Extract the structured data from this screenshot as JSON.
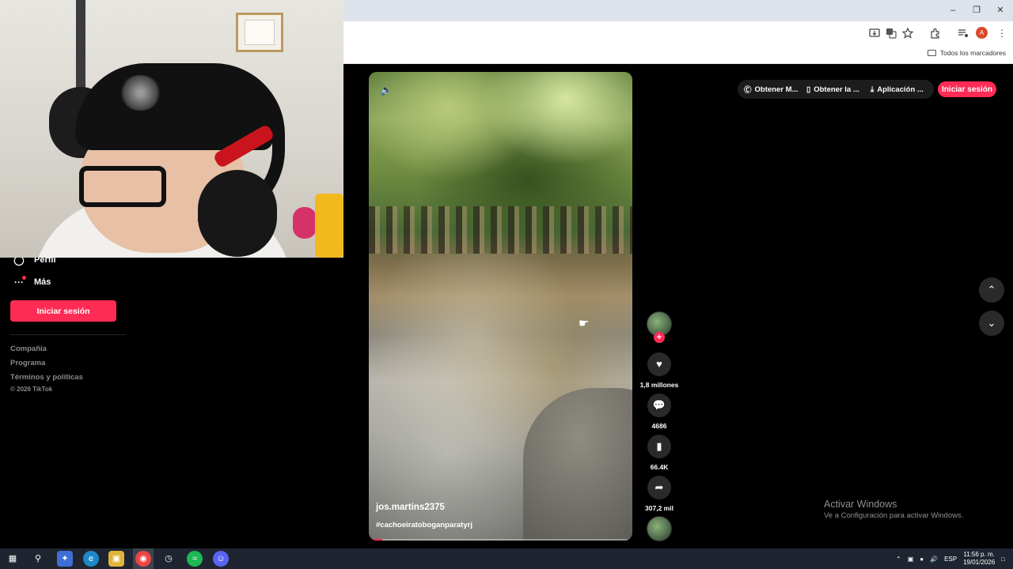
{
  "sidebar": {
    "items": [
      {
        "label": "Perfil",
        "icon": "person-icon"
      },
      {
        "label": "Más",
        "icon": "more-icon"
      }
    ],
    "login_label": "Iniciar sesión",
    "footer_links": [
      "Compañía",
      "Programa",
      "Términos y políticas"
    ],
    "copyright": "© 2026 TikTok"
  },
  "video": {
    "username": "jos.martins2375",
    "hashtag": "#cachoeiratoboganparatyrj",
    "progress_fraction": 0.05
  },
  "actions": {
    "likes": "1,8 millones",
    "comments": "4686",
    "saves": "66.4K",
    "shares": "307,2 mil"
  },
  "header": {
    "pill1": "Obtener M...",
    "pill2": "Obtener la ...",
    "pill3": "Aplicación ...",
    "login_label": "Iniciar sesión"
  },
  "browser": {
    "bookmarks_label": "Todos los marcadores",
    "profile_initial": "A"
  },
  "watermark": {
    "title": "Activar Windows",
    "subtitle": "Ve a Configuración para activar Windows."
  },
  "taskbar": {
    "language": "ESP",
    "time": "11:56 p. m.",
    "date": "19/01/2026"
  },
  "colors": {
    "accent": "#fe2c55",
    "background": "#000000",
    "taskbar": "#1f2530"
  }
}
